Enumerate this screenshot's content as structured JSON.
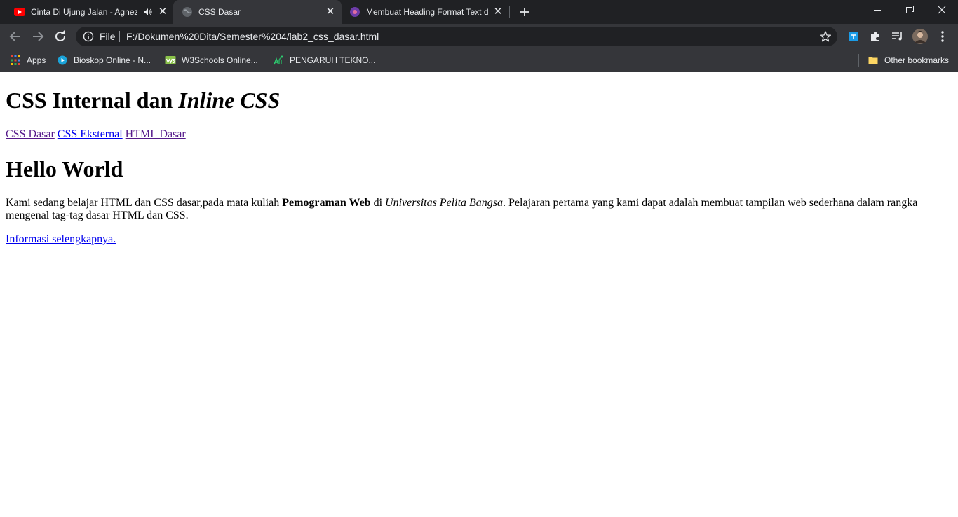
{
  "browser": {
    "tabs": [
      {
        "title": "Cinta Di Ujung Jalan - Agnez",
        "audio": true
      },
      {
        "title": "CSS Dasar",
        "active": true
      },
      {
        "title": "Membuat Heading Format Text d"
      }
    ],
    "address": {
      "scheme_label": "File",
      "url": "F:/Dokumen%20Dita/Semester%204/lab2_css_dasar.html"
    },
    "bookmarks": [
      {
        "label": "Apps"
      },
      {
        "label": "Bioskop Online - N..."
      },
      {
        "label": "W3Schools Online..."
      },
      {
        "label": "PENGARUH TEKNO..."
      }
    ],
    "other_bookmarks": "Other bookmarks"
  },
  "page": {
    "heading": {
      "plain": "CSS Internal dan ",
      "italic": "Inline CSS"
    },
    "nav": [
      {
        "label": "CSS Dasar",
        "visited": true
      },
      {
        "label": "CSS Eksternal",
        "visited": false
      },
      {
        "label": "HTML Dasar",
        "visited": true
      }
    ],
    "subheading": "Hello World",
    "intro": {
      "part1": "Kami sedang belajar HTML dan CSS dasar,pada mata kuliah ",
      "bold": "Pemograman Web",
      "part2": " di ",
      "italic": "Universitas Pelita Bangsa",
      "part3": ". Pelajaran pertama yang kami dapat adalah membuat tampilan web sederhana dalam rangka mengenal tag-tag dasar HTML dan CSS."
    },
    "more_link": "Informasi selengkapnya."
  },
  "colors": {
    "chrome_dark": "#202124",
    "chrome_mid": "#35363a",
    "link": "#0000ee",
    "link_visited": "#551a8b"
  }
}
